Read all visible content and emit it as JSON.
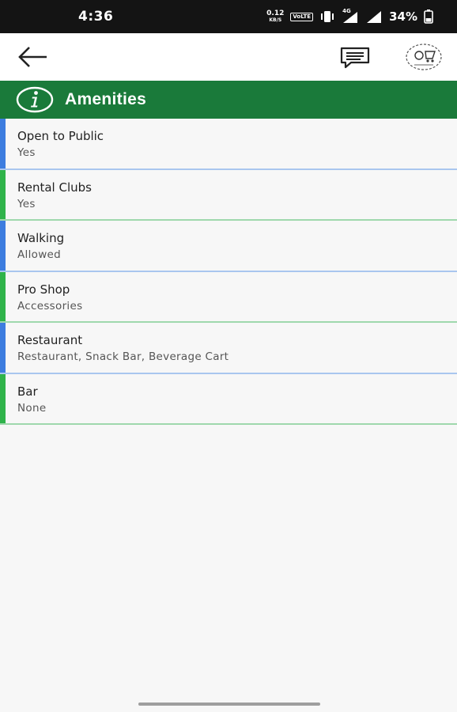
{
  "status_bar": {
    "time": "4:36",
    "net_speed_value": "0.12",
    "net_speed_unit": "KB/S",
    "volte_label": "VoLTE",
    "network_type": "4G",
    "battery_percent": "34%"
  },
  "header": {
    "back_icon": "arrow-left-icon",
    "chat_icon": "chat-bubble-icon",
    "logo_icon": "golf-logo-icon"
  },
  "section": {
    "title": "Amenities",
    "icon": "info-circle-icon",
    "background_color": "#1a7a3a"
  },
  "amenities": [
    {
      "label": "Open to Public",
      "value": "Yes",
      "accent": "#3d7ddf"
    },
    {
      "label": "Rental Clubs",
      "value": "Yes",
      "accent": "#2fb34a"
    },
    {
      "label": "Walking",
      "value": "Allowed",
      "accent": "#3d7ddf"
    },
    {
      "label": "Pro Shop",
      "value": "Accessories",
      "accent": "#2fb34a"
    },
    {
      "label": "Restaurant",
      "value": "Restaurant, Snack Bar, Beverage Cart",
      "accent": "#3d7ddf"
    },
    {
      "label": "Bar",
      "value": "None",
      "accent": "#2fb34a"
    }
  ]
}
